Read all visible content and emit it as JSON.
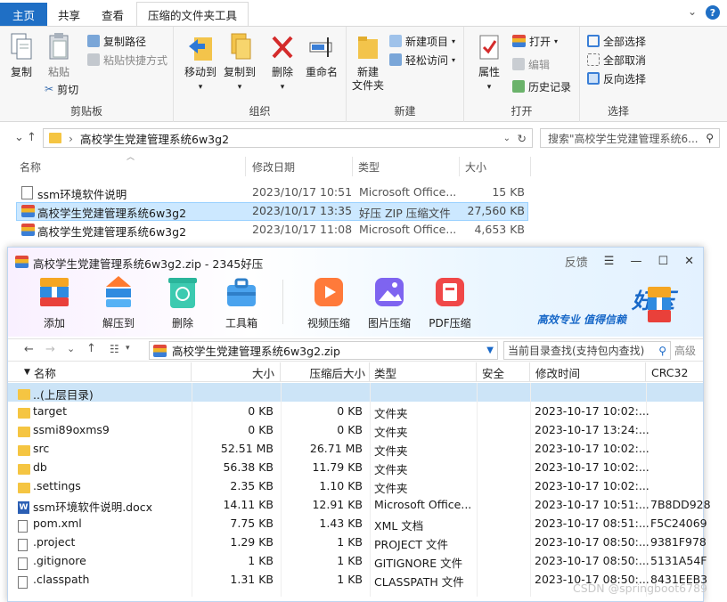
{
  "explorer": {
    "tabs": [
      "主页",
      "共享",
      "查看",
      "压缩的文件夹工具"
    ],
    "ribbon": {
      "clipboard": {
        "label": "剪贴板",
        "copy": "复制",
        "paste": "粘贴",
        "copy_path": "复制路径",
        "paste_shortcut": "粘贴快捷方式",
        "cut": "剪切"
      },
      "organize": {
        "label": "组织",
        "move_to": "移动到",
        "copy_to": "复制到",
        "delete": "删除",
        "rename": "重命名"
      },
      "new": {
        "label": "新建",
        "new_folder": "新建\n文件夹",
        "new_item": "新建项目",
        "easy_access": "轻松访问"
      },
      "open": {
        "label": "打开",
        "properties": "属性",
        "open": "打开",
        "edit": "编辑",
        "history": "历史记录"
      },
      "select": {
        "label": "选择",
        "select_all": "全部选择",
        "select_none": "全部取消",
        "invert": "反向选择"
      }
    },
    "address": "高校学生党建管理系统6w3g2",
    "search_placeholder": "搜索\"高校学生党建管理系统6...",
    "columns": [
      "名称",
      "修改日期",
      "类型",
      "大小"
    ],
    "files": [
      {
        "name": "ssm环境软件说明",
        "date": "2023/10/17 10:51",
        "type": "Microsoft Office...",
        "size": "15 KB"
      },
      {
        "name": "高校学生党建管理系统6w3g2",
        "date": "2023/10/17 13:35",
        "type": "好压 ZIP 压缩文件",
        "size": "27,560 KB"
      },
      {
        "name": "高校学生党建管理系统6w3g2",
        "date": "2023/10/17 11:08",
        "type": "Microsoft Office...",
        "size": "4,653 KB"
      }
    ]
  },
  "haozip": {
    "title": "高校学生党建管理系统6w3g2.zip - 2345好压",
    "feedback": "反馈",
    "toolbar": [
      "添加",
      "解压到",
      "删除",
      "工具箱",
      "视频压缩",
      "图片压缩",
      "PDF压缩"
    ],
    "brand": "好压",
    "slogan": "高效专业  值得信赖",
    "address": "高校学生党建管理系统6w3g2.zip",
    "search_placeholder": "当前目录查找(支持包内查找)",
    "advanced": "高级",
    "columns": [
      "名称",
      "大小",
      "压缩后大小",
      "类型",
      "安全",
      "修改时间",
      "CRC32"
    ],
    "rows": [
      {
        "name": "..(上层目录)",
        "size": "",
        "packed": "",
        "type": "",
        "time": "",
        "crc": "",
        "icon": "folder"
      },
      {
        "name": "target",
        "size": "0 KB",
        "packed": "0 KB",
        "type": "文件夹",
        "time": "2023-10-17 10:02:...",
        "crc": "",
        "icon": "folder"
      },
      {
        "name": "ssmi89oxms9",
        "size": "0 KB",
        "packed": "0 KB",
        "type": "文件夹",
        "time": "2023-10-17 13:24:...",
        "crc": "",
        "icon": "folder"
      },
      {
        "name": "src",
        "size": "52.51 MB",
        "packed": "26.71 MB",
        "type": "文件夹",
        "time": "2023-10-17 10:02:...",
        "crc": "",
        "icon": "folder"
      },
      {
        "name": "db",
        "size": "56.38 KB",
        "packed": "11.79 KB",
        "type": "文件夹",
        "time": "2023-10-17 10:02:...",
        "crc": "",
        "icon": "folder"
      },
      {
        "name": ".settings",
        "size": "2.35 KB",
        "packed": "1.10 KB",
        "type": "文件夹",
        "time": "2023-10-17 10:02:...",
        "crc": "",
        "icon": "folder"
      },
      {
        "name": "ssm环境软件说明.docx",
        "size": "14.11 KB",
        "packed": "12.91 KB",
        "type": "Microsoft Office...",
        "time": "2023-10-17 10:51:...",
        "crc": "7B8DD928",
        "icon": "word"
      },
      {
        "name": "pom.xml",
        "size": "7.75 KB",
        "packed": "1.43 KB",
        "type": "XML 文档",
        "time": "2023-10-17 08:51:...",
        "crc": "F5C24069",
        "icon": "file"
      },
      {
        "name": ".project",
        "size": "1.29 KB",
        "packed": "1 KB",
        "type": "PROJECT 文件",
        "time": "2023-10-17 08:50:...",
        "crc": "9381F978",
        "icon": "file"
      },
      {
        "name": ".gitignore",
        "size": "1 KB",
        "packed": "1 KB",
        "type": "GITIGNORE 文件",
        "time": "2023-10-17 08:50:...",
        "crc": "5131A54F",
        "icon": "file"
      },
      {
        "name": ".classpath",
        "size": "1.31 KB",
        "packed": "1 KB",
        "type": "CLASSPATH 文件",
        "time": "2023-10-17 08:50:...",
        "crc": "8431EEB3",
        "icon": "file"
      }
    ]
  },
  "watermark": "CSDN @springboot6789"
}
